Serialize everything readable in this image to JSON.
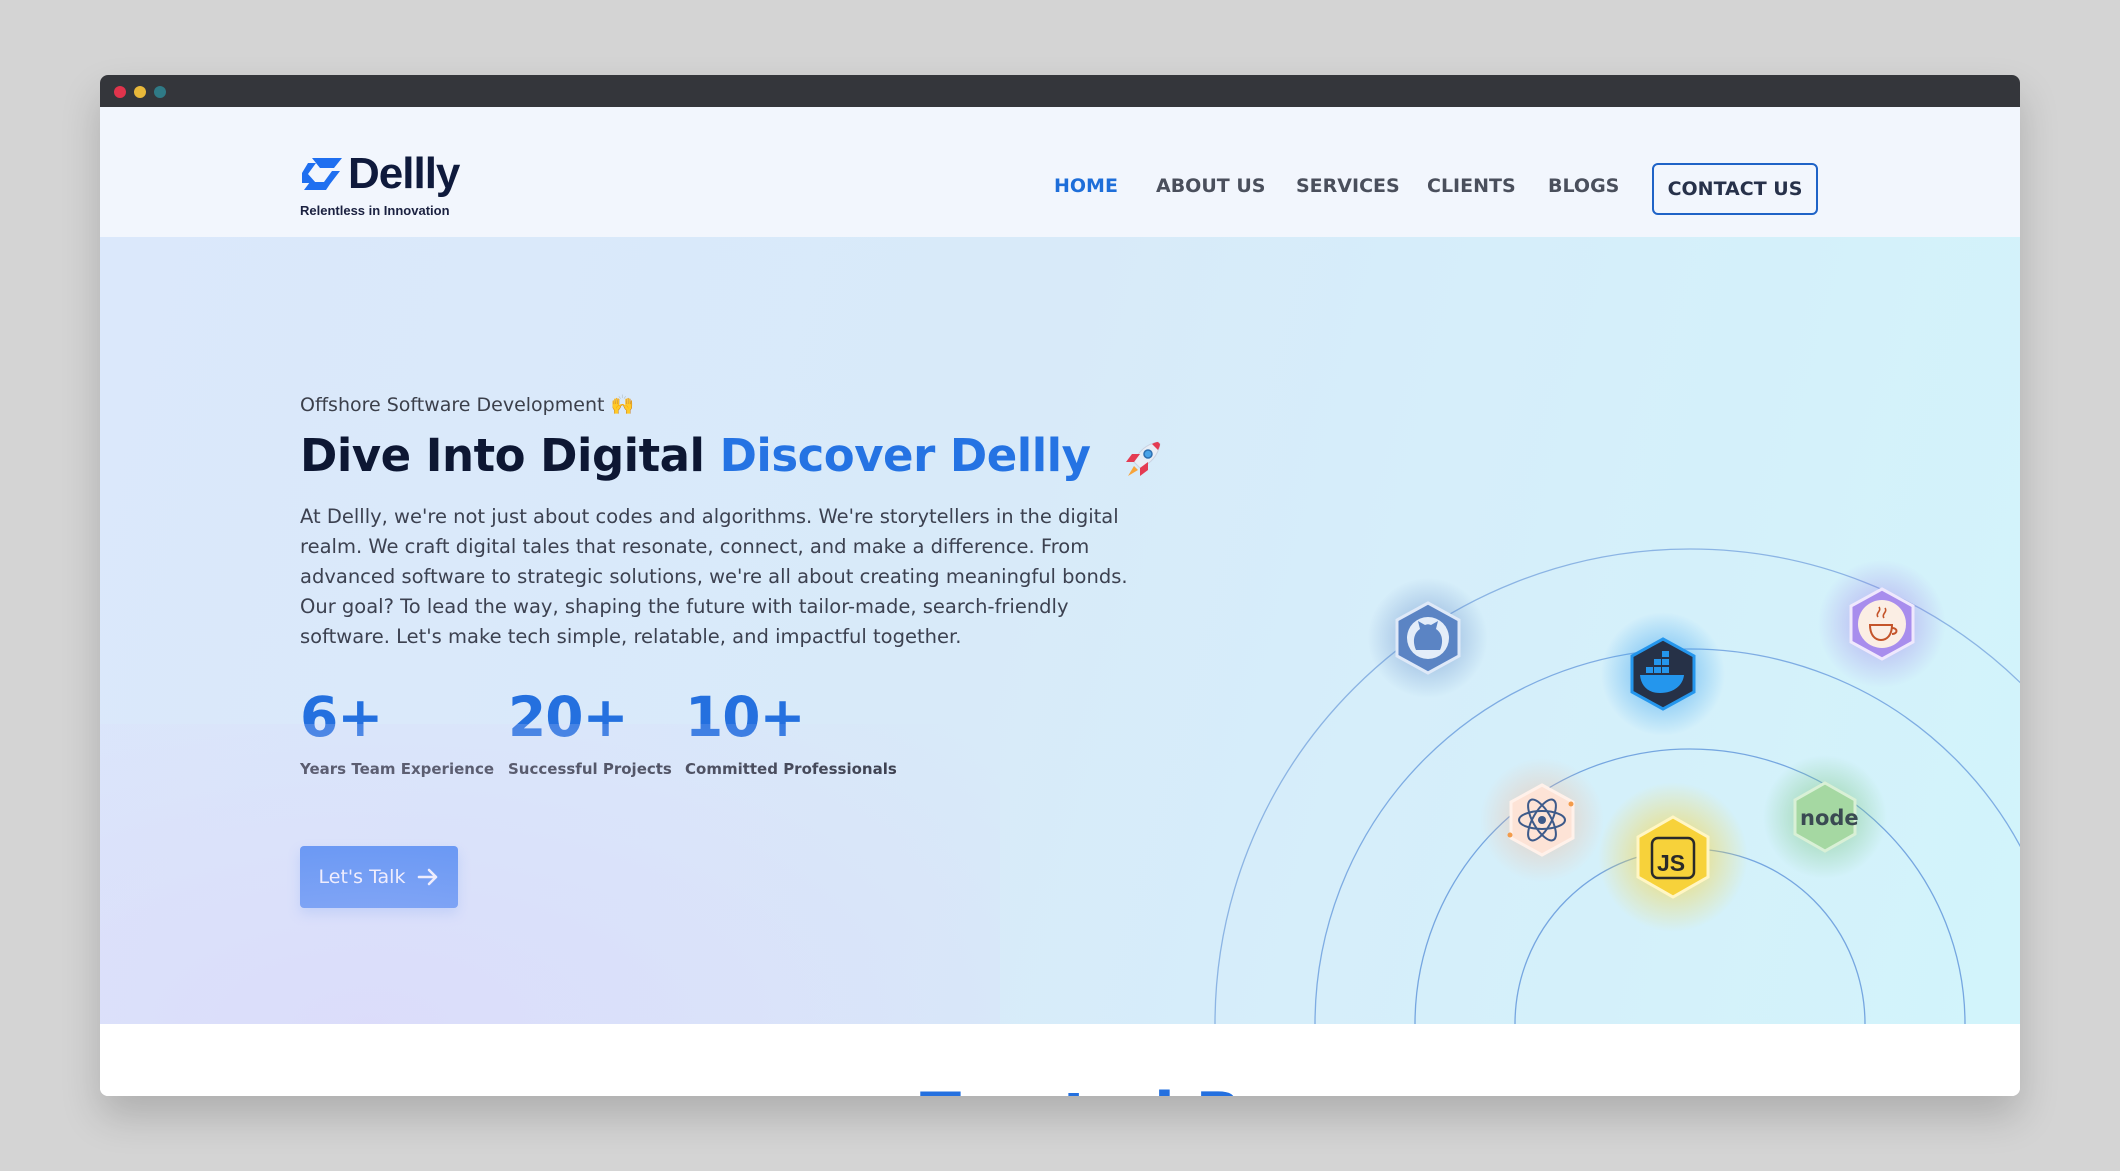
{
  "window": {
    "controls": [
      "close",
      "minimize",
      "zoom"
    ]
  },
  "brand": {
    "name": "Dellly",
    "tagline": "Relentless in Innovation",
    "logo_icon": "dellly-logo-icon",
    "color": "#1f6ff0"
  },
  "nav": {
    "items": [
      {
        "label": "HOME",
        "active": true
      },
      {
        "label": "ABOUT US",
        "active": false
      },
      {
        "label": "SERVICES",
        "active": false
      },
      {
        "label": "CLIENTS",
        "active": false
      },
      {
        "label": "BLOGS",
        "active": false
      }
    ],
    "contact_label": "CONTACT US"
  },
  "hero": {
    "eyebrow": "Offshore Software Development 🙌",
    "headline_plain": "Dive Into Digital",
    "headline_accent": "Discover Dellly",
    "headline_icon": "rocket-icon",
    "intro": "At Dellly, we're not just about codes and algorithms. We're storytellers in the digital realm. We craft digital tales that resonate, connect, and make a difference. From advanced software to strategic solutions, we're all about creating meaningful bonds. Our goal? To lead the way, shaping the future with tailor-made, search-friendly software. Let's make tech simple, relatable, and impactful together.",
    "stats": [
      {
        "value": "6+",
        "label": "Years Team Experience"
      },
      {
        "value": "20+",
        "label": "Successful Projects"
      },
      {
        "value": "10+",
        "label": "Committed Professionals"
      }
    ],
    "cta_label": "Let's Talk",
    "cta_icon": "arrow-right-icon",
    "tech_icons": [
      {
        "name": "github-icon",
        "color": "#5b84c4"
      },
      {
        "name": "docker-icon",
        "color": "#2496ed"
      },
      {
        "name": "java-icon",
        "color": "#9b7be8"
      },
      {
        "name": "react-icon",
        "color": "#f6b08a"
      },
      {
        "name": "javascript-icon",
        "color": "#f7d23a"
      },
      {
        "name": "nodejs-icon",
        "color": "#7bc47f"
      }
    ],
    "js_badge_text": "JS",
    "node_badge_text": "node"
  },
  "next_section": {
    "heading_partial": "Trusted B"
  },
  "colors": {
    "accent": "#2470df",
    "heading": "#0d1733",
    "button": "#1f6ff0"
  }
}
